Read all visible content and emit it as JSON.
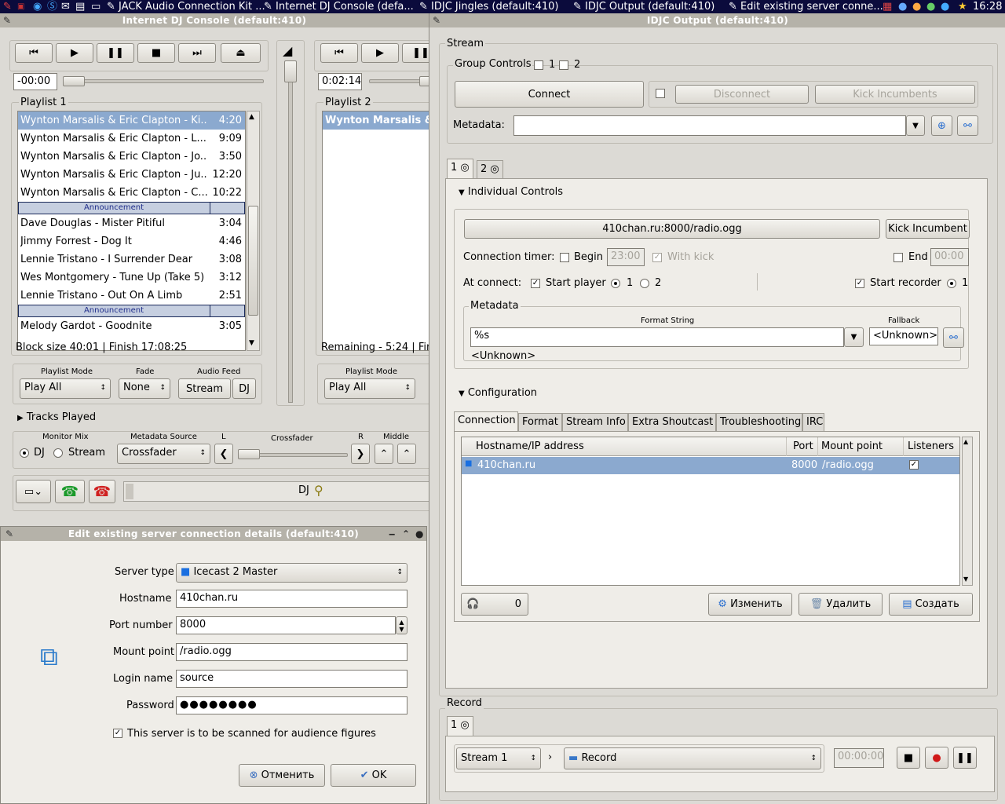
{
  "taskbar": {
    "items": [
      "JACK Audio Connection Kit ...",
      "Internet DJ Console  (defa...",
      "IDJC Jingles  (default:410)",
      "IDJC Output  (default:410)",
      "Edit existing server conne..."
    ],
    "clock": "16:28"
  },
  "console": {
    "title": "Internet DJ Console  (default:410)",
    "player1": {
      "time": "-00:00",
      "playlist_label": "Playlist 1",
      "tracks": [
        {
          "title": "Wynton Marsalis & Eric Clapton - Ki...",
          "dur": "4:20",
          "type": "sel"
        },
        {
          "title": "Wynton Marsalis & Eric Clapton - L...",
          "dur": "9:09",
          "type": "track"
        },
        {
          "title": "Wynton Marsalis & Eric Clapton - Jo...",
          "dur": "3:50",
          "type": "track"
        },
        {
          "title": "Wynton Marsalis & Eric Clapton - Ju...",
          "dur": "12:20",
          "type": "track"
        },
        {
          "title": "Wynton Marsalis & Eric Clapton - C...",
          "dur": "10:22",
          "type": "track"
        },
        {
          "title": "Announcement",
          "dur": "",
          "type": "ann"
        },
        {
          "title": "Dave Douglas - Mister Pitiful",
          "dur": "3:04",
          "type": "track"
        },
        {
          "title": "Jimmy Forrest - Dog It",
          "dur": "4:46",
          "type": "track"
        },
        {
          "title": "Lennie Tristano - I Surrender Dear",
          "dur": "3:08",
          "type": "track"
        },
        {
          "title": "Wes Montgomery - Tune Up (Take 5)",
          "dur": "3:12",
          "type": "track"
        },
        {
          "title": "Lennie Tristano - Out On A Limb",
          "dur": "2:51",
          "type": "track"
        },
        {
          "title": "Announcement",
          "dur": "",
          "type": "ann"
        },
        {
          "title": "Melody Gardot - Goodnite",
          "dur": "3:05",
          "type": "track"
        }
      ],
      "status": "Block size 40:01 | Finish 17:08:25",
      "playlist_mode_label": "Playlist Mode",
      "playlist_mode": "Play All",
      "fade_label": "Fade",
      "fade": "None",
      "audio_feed_label": "Audio Feed",
      "stream_btn": "Stream",
      "dj_btn": "DJ"
    },
    "player2": {
      "time": "0:02:14",
      "playlist_label": "Playlist 2",
      "first_track": "Wynton Marsalis &",
      "status": "Remaining - 5:24 | Fin",
      "playlist_mode_label": "Playlist Mode",
      "playlist_mode": "Play All"
    },
    "tracks_played": "Tracks Played",
    "monitor_mix_label": "Monitor Mix",
    "monitor_dj": "DJ",
    "monitor_stream": "Stream",
    "metadata_source_label": "Metadata Source",
    "metadata_source": "Crossfader",
    "l_label": "L",
    "crossfader_label": "Crossfader",
    "r_label": "R",
    "middle_label": "Middle",
    "dj_label": "DJ"
  },
  "dialog": {
    "title": "Edit existing server connection details  (default:410)",
    "server_type_label": "Server type",
    "server_type": "Icecast 2 Master",
    "hostname_label": "Hostname",
    "hostname": "410chan.ru",
    "port_label": "Port number",
    "port": "8000",
    "mount_label": "Mount point",
    "mount": "/radio.ogg",
    "login_label": "Login name",
    "login": "source",
    "password_label": "Password",
    "password": "●●●●●●●●",
    "scan_label": "This server is to be scanned for audience figures",
    "cancel": "Отменить",
    "ok": "OK"
  },
  "output": {
    "title": "IDJC Output  (default:410)",
    "stream_label": "Stream",
    "group_controls": "Group Controls",
    "group1": "1",
    "group2": "2",
    "connect": "Connect",
    "disconnect": "Disconnect",
    "kick_incumbents": "Kick Incumbents",
    "metadata_label": "Metadata:",
    "tab1": "1",
    "tab2": "2",
    "individual_controls": "Individual Controls",
    "server_button": "410chan.ru:8000/radio.ogg",
    "kick_incumbent": "Kick Incumbent",
    "conn_timer": "Connection timer:",
    "begin": "Begin",
    "begin_time": "23:00",
    "with_kick": "With kick",
    "end": "End",
    "end_time": "00:00",
    "at_connect": "At connect:",
    "start_player": "Start player",
    "sp1": "1",
    "sp2": "2",
    "start_recorder": "Start recorder",
    "sr1": "1",
    "metadata_group": "Metadata",
    "format_string_label": "Format String",
    "format_string": "%s",
    "fallback_label": "Fallback",
    "fallback": "<Unknown>",
    "preview": "<Unknown>",
    "configuration": "Configuration",
    "config_tabs": [
      "Connection",
      "Format",
      "Stream Info",
      "Extra Shoutcast",
      "Troubleshooting",
      "IRC"
    ],
    "table_headers": [
      "Hostname/IP address",
      "Port",
      "Mount point",
      "Listeners"
    ],
    "table_row": {
      "host": "410chan.ru",
      "port": "8000",
      "mount": "/radio.ogg"
    },
    "listeners_count": "0",
    "edit_btn": "Изменить",
    "delete_btn": "Удалить",
    "create_btn": "Создать",
    "record_label": "Record",
    "record_tab": "1",
    "record_source": "Stream  1",
    "record_dest": "Record",
    "record_time": "00:00:00"
  }
}
